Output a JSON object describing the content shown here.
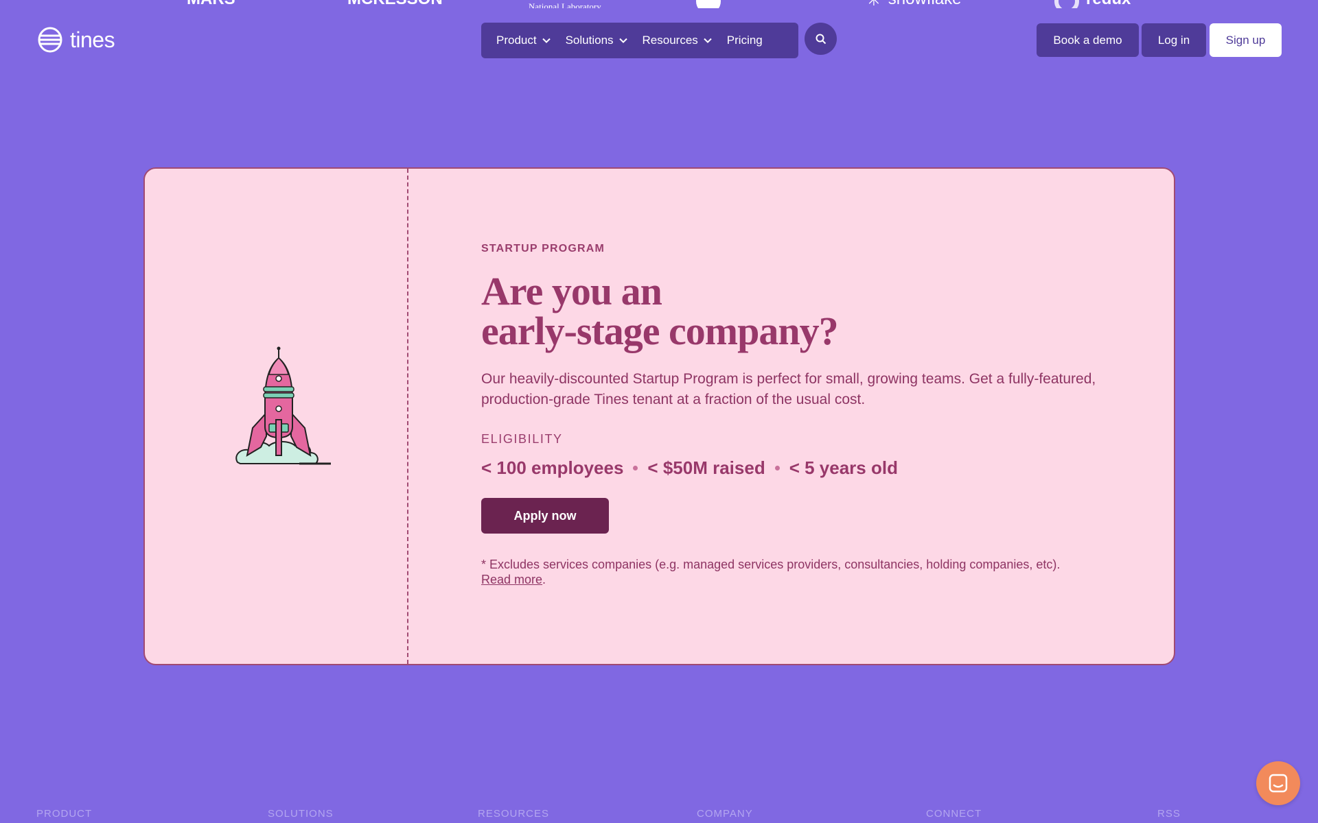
{
  "logos": [
    {
      "name": "Mars",
      "text": "MARS"
    },
    {
      "name": "McKesson",
      "text": "MCKESSON"
    },
    {
      "name": "National Laboratory",
      "text": "National Laboratory"
    },
    {
      "name": "Snowflake",
      "text": "snowflake"
    },
    {
      "name": "Redux",
      "text": "redux"
    }
  ],
  "header": {
    "brand": "tines",
    "nav": [
      {
        "label": "Product",
        "has_dropdown": true
      },
      {
        "label": "Solutions",
        "has_dropdown": true
      },
      {
        "label": "Resources",
        "has_dropdown": true
      },
      {
        "label": "Pricing",
        "has_dropdown": false
      }
    ],
    "search_icon": "search-icon",
    "book_demo": "Book a demo",
    "login": "Log in",
    "signup": "Sign up"
  },
  "card": {
    "eyebrow": "STARTUP PROGRAM",
    "headline_line1": "Are you an",
    "headline_line2": "early-stage company?",
    "description": "Our heavily-discounted Startup Program is perfect for small, growing teams. Get a fully-featured, production-grade Tines tenant at a fraction of the usual cost.",
    "eligibility_label": "ELIGIBILITY",
    "eligibility": [
      "< 100 employees",
      "< $50M raised",
      "< 5 years old"
    ],
    "apply_button": "Apply now",
    "footnote": "* Excludes services companies (e.g. managed services providers, consultancies, holding companies, etc).",
    "read_more": "Read more",
    "illustration": "rocket-illustration"
  },
  "footer": {
    "headings": [
      "PRODUCT",
      "SOLUTIONS",
      "RESOURCES",
      "COMPANY",
      "CONNECT",
      "RSS"
    ]
  },
  "colors": {
    "page_bg": "#8068e2",
    "nav_bg": "#4f3b99",
    "card_bg": "#fdd8e6",
    "card_border": "#a14a72",
    "accent_text": "#98386a",
    "apply_button": "#6b2350",
    "chat_button": "#f28a5b"
  }
}
